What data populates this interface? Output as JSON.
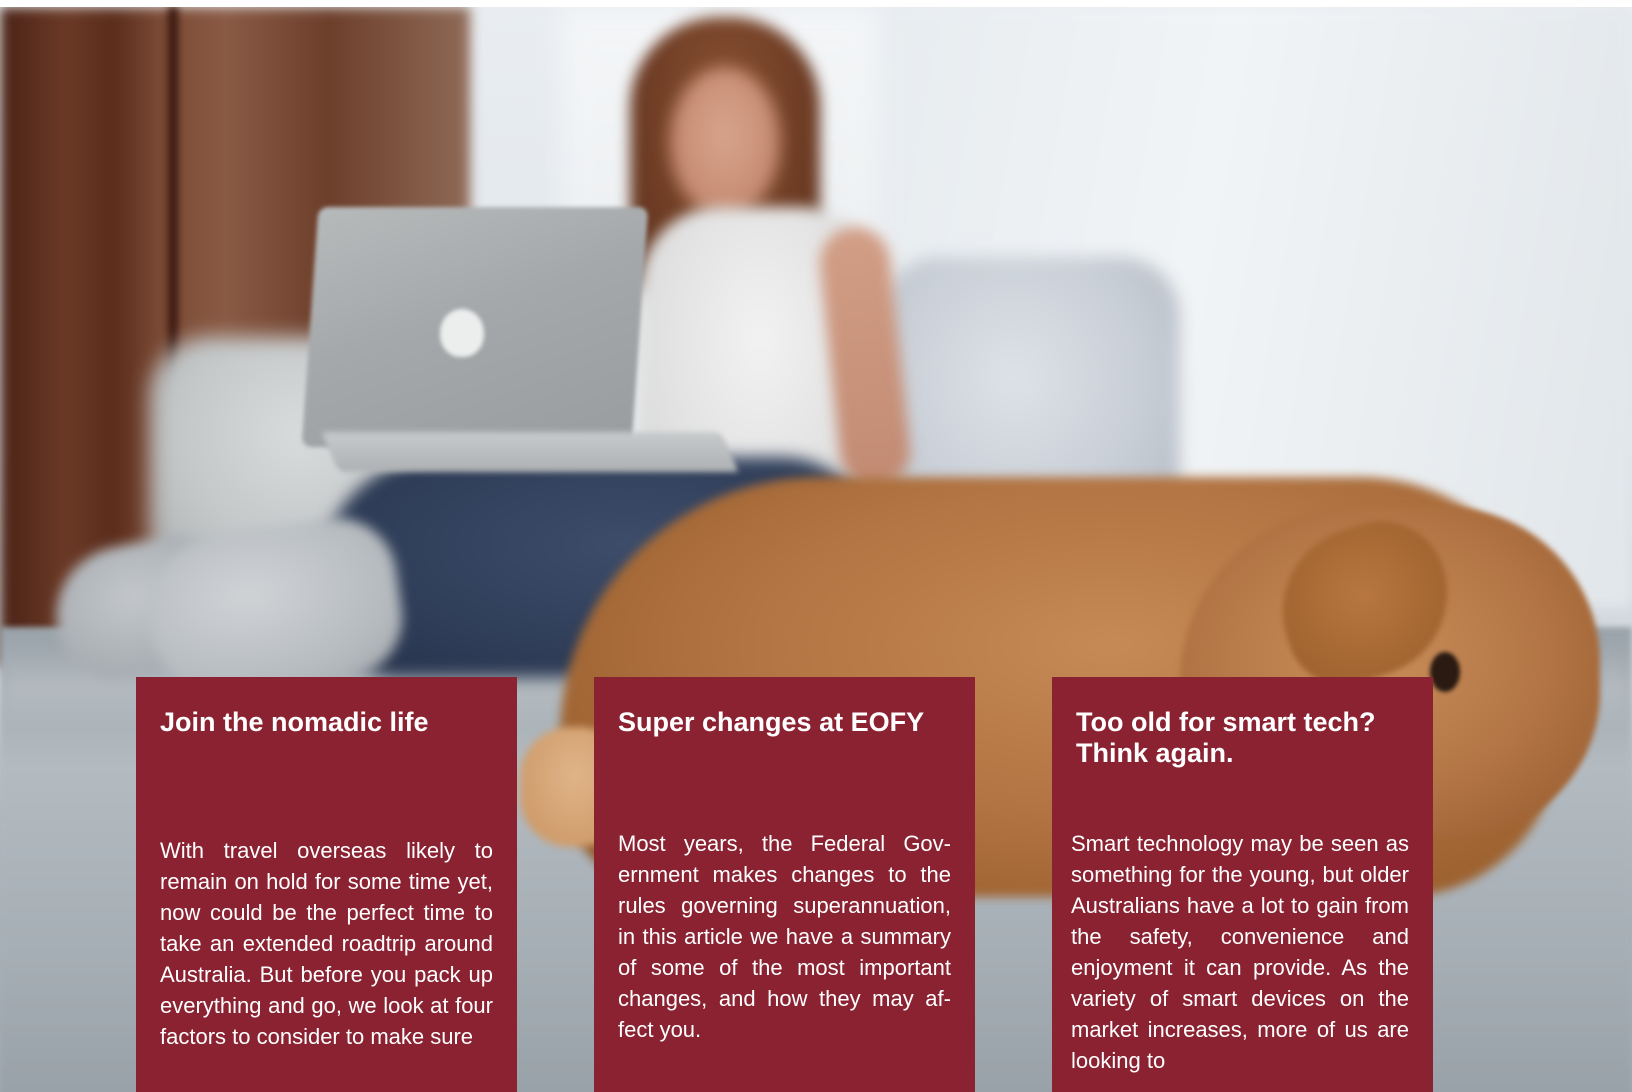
{
  "hero": {
    "alt_subject": "photo"
  },
  "articles": [
    {
      "title": "Join the nomadic life",
      "body": "With travel overseas likely to remain on hold for some time yet, now could be the perfect time to take an extended roadtrip around Australia. But before you pack up everything and go, we look at four factors to consider to make sure"
    },
    {
      "title": "Super changes at EOFY",
      "body": "Most years, the Federal Gov­ernment makes changes to the rules governing superannuation, in this article we have a summa­ry of some of the most important changes, and how they may af­fect you."
    },
    {
      "title": "Too old for smart tech?\nThink again.",
      "body": "Smart technology may be seen as something for the young, but older Australians have a lot to gain from the safety, convenience and enjoy­ment it can provide. As the variety of smart devices on the market in­creases, more of us are looking to"
    }
  ],
  "colors": {
    "card_background": "#8b2232",
    "card_text": "#ffffff"
  }
}
